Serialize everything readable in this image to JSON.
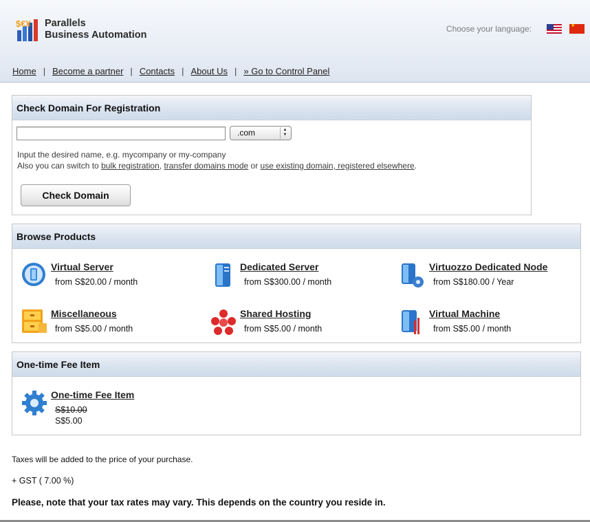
{
  "header": {
    "brand_line1": "Parallels",
    "brand_line2": "Business Automation",
    "language_label": "Choose your language:",
    "languages": [
      {
        "icon": "us-flag-icon"
      },
      {
        "icon": "china-flag-icon"
      }
    ]
  },
  "nav": {
    "items": [
      "Home",
      "Become a partner",
      "Contacts",
      "About Us",
      "» Go to Control Panel"
    ],
    "separator": "|"
  },
  "domain_check": {
    "title": "Check Domain For Registration",
    "input_value": "",
    "tld_selected": ".com",
    "hint_line1": "Input the desired name, e.g. mycompany or my-company",
    "hint_prefix": "Also you can switch to ",
    "link_bulk": "bulk registration",
    "hint_comma": ", ",
    "link_transfer": "transfer domains mode",
    "hint_or": " or ",
    "link_existing": "use existing domain, registered elsewhere",
    "hint_end": ".",
    "button_label": "Check Domain"
  },
  "products": {
    "title": "Browse Products",
    "items": [
      {
        "name": "Virtual Server",
        "price": "from S$20.00 / month",
        "icon": "virtual-server-icon"
      },
      {
        "name": "Dedicated Server",
        "price": "from S$300.00 / month",
        "icon": "dedicated-server-icon"
      },
      {
        "name": "Virtuozzo Dedicated Node",
        "price": "from S$180.00 / Year",
        "icon": "virtuozzo-node-icon"
      },
      {
        "name": "Miscellaneous",
        "price": "from S$5.00 / month",
        "icon": "cabinet-icon"
      },
      {
        "name": "Shared Hosting",
        "price": "from S$5.00 / month",
        "icon": "shared-hosting-icon"
      },
      {
        "name": "Virtual Machine",
        "price": "from S$5.00 / month",
        "icon": "virtual-machine-icon"
      }
    ]
  },
  "one_time_fee": {
    "title": "One-time Fee Item",
    "item_name": "One-time Fee Item",
    "old_price": "S$10.00",
    "new_price": "S$5.00",
    "icon": "gear-icon"
  },
  "taxes": {
    "line1": "Taxes will be added to the price of your purchase.",
    "line2": "+ GST ( 7.00 %)",
    "line3": "Please, note that your tax rates may vary. This depends on the country you reside in."
  },
  "colors": {
    "header_gradient_top": "#f6f8fb",
    "panel_head_bottom": "#cfdbea",
    "icon_blue": "#2f7fd0"
  }
}
